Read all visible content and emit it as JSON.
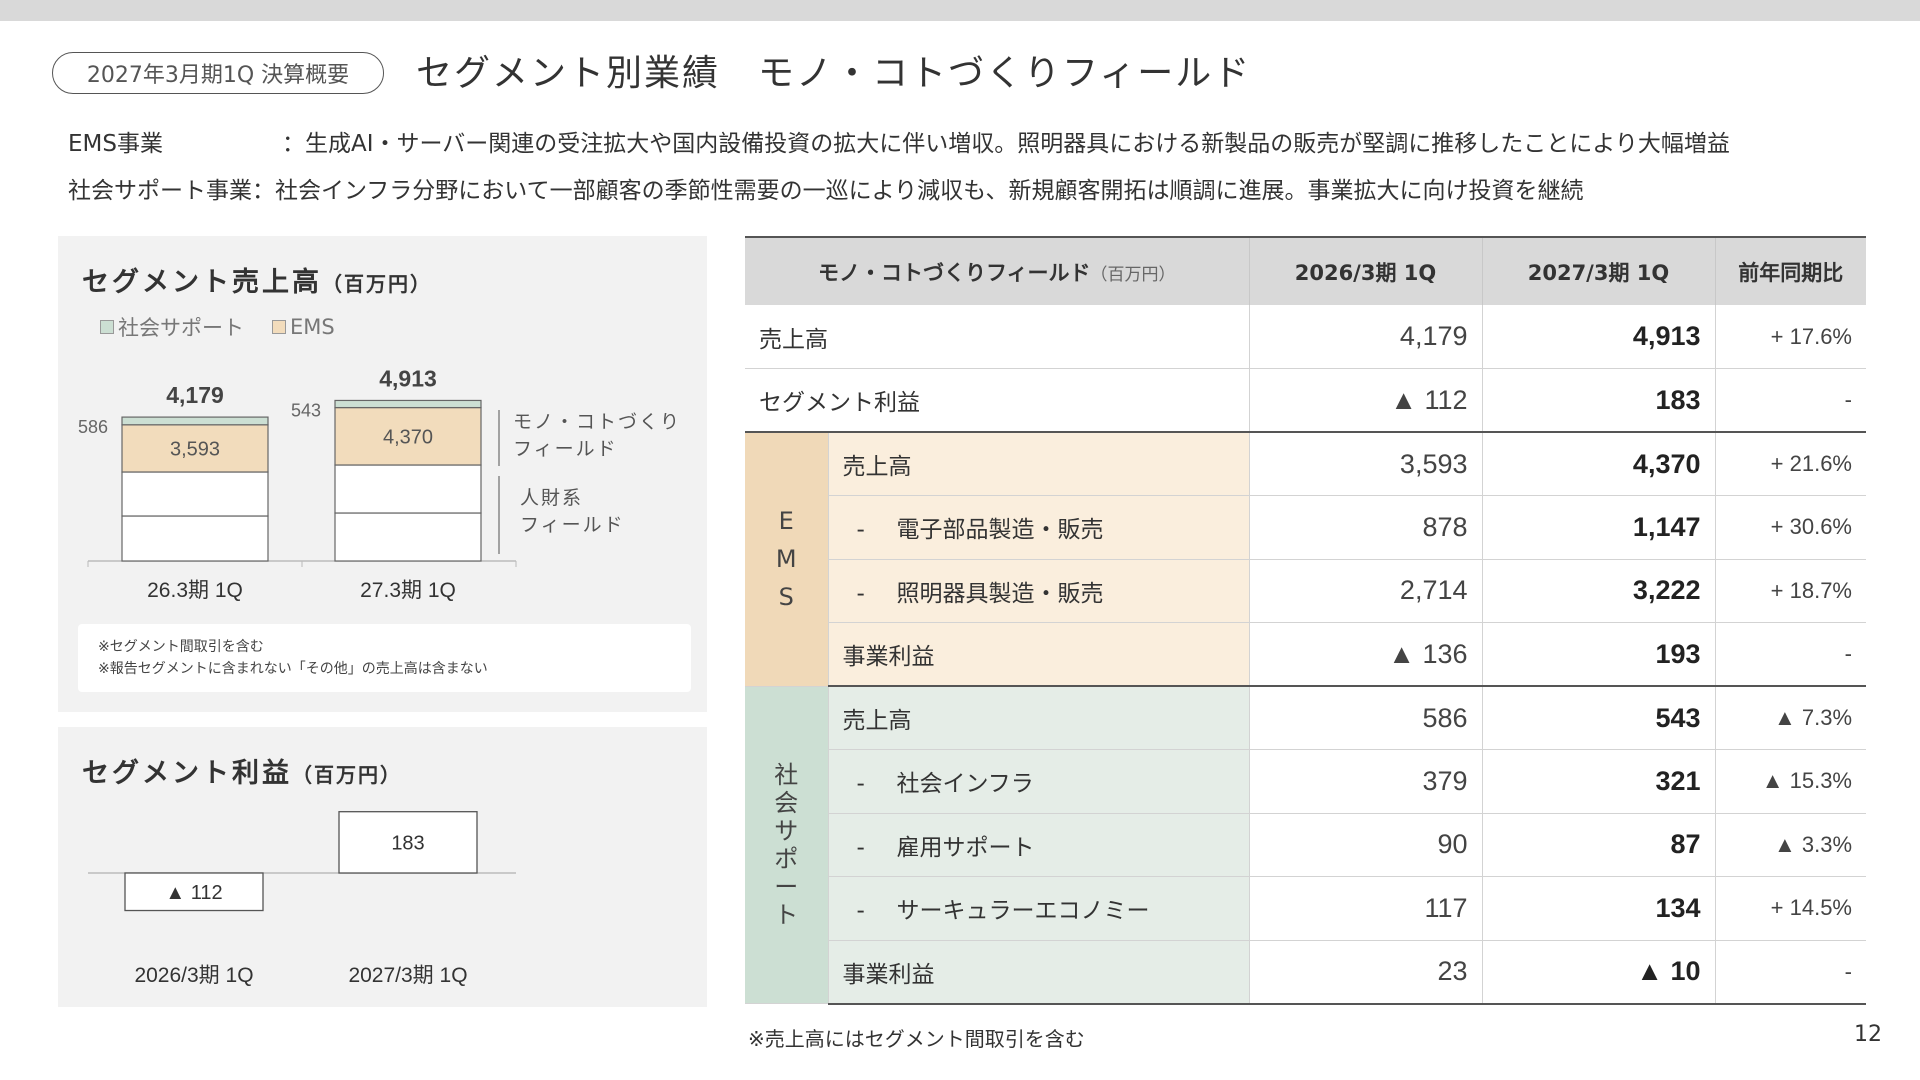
{
  "header": {
    "period_badge": "2027年3月期1Q 決算概要",
    "title": "セグメント別業績　モノ・コトづくりフィールド"
  },
  "summary": [
    {
      "label": "EMS事業",
      "text": "：生成AI・サーバー関連の受注拡大や国内設備投資の拡大に伴い増収。照明器具における新製品の販売が堅調に推移したことにより大幅増益"
    },
    {
      "label": "社会サポート事業",
      "text": "：社会インフラ分野において一部顧客の季節性需要の一巡により減収も、新規顧客開拓は順調に進展。事業拡大に向け投資を継続"
    }
  ],
  "sales_panel": {
    "title": "セグメント売上高",
    "unit": "（百万円）",
    "legend": [
      "社会サポート",
      "EMS"
    ],
    "group_labels": [
      "モノ・コトづくり\nフィールド",
      "人財系\nフィールド"
    ],
    "group_label_lines": [
      [
        "モノ・コトづくり",
        "フィールド"
      ],
      [
        "人財系",
        "フィールド"
      ]
    ],
    "notes": [
      "※セグメント間取引を含む",
      "※報告セグメントに含まれない「その他」の売上高は含まない"
    ]
  },
  "profit_panel": {
    "title": "セグメント利益",
    "unit": "（百万円）"
  },
  "chart_data": [
    {
      "type": "bar",
      "title": "セグメント売上高（百万円）",
      "stacked": true,
      "categories": [
        "26.3期 1Q",
        "27.3期 1Q"
      ],
      "series": [
        {
          "name": "EMS",
          "values": [
            3593,
            4370
          ],
          "color": "#f2dcbc"
        },
        {
          "name": "社会サポート",
          "values": [
            586,
            543
          ],
          "color": "#ccdfd3"
        }
      ],
      "totals": [
        "4,179",
        "4,913"
      ],
      "value_labels": {
        "EMS": [
          "3,593",
          "4,370"
        ],
        "社会サポート": [
          "586",
          "543"
        ]
      }
    },
    {
      "type": "bar",
      "title": "セグメント利益（百万円）",
      "categories": [
        "2026/3期 1Q",
        "2027/3期 1Q"
      ],
      "values": [
        -112,
        183
      ],
      "value_labels": [
        "▲ 112",
        "183"
      ]
    }
  ],
  "table": {
    "headers": [
      "モノ・コトづくりフィールド",
      "2026/3期 1Q",
      "2027/3期 1Q",
      "前年同期比"
    ],
    "header_unit": "（百万円）",
    "top_rows": [
      {
        "label": "売上高",
        "prev": "4,179",
        "curr": "4,913",
        "yoy": "+ 17.6%"
      },
      {
        "label": "セグメント利益",
        "prev": "▲ 112",
        "curr": "183",
        "yoy": "-"
      }
    ],
    "ems": {
      "segment": [
        "E",
        "M",
        "S"
      ],
      "rows": [
        {
          "dash": "",
          "label": "売上高",
          "prev": "3,593",
          "curr": "4,370",
          "yoy": "+ 21.6%"
        },
        {
          "dash": "-",
          "label": "電子部品製造・販売",
          "prev": "878",
          "curr": "1,147",
          "yoy": "+ 30.6%"
        },
        {
          "dash": "-",
          "label": "照明器具製造・販売",
          "prev": "2,714",
          "curr": "3,222",
          "yoy": "+ 18.7%"
        },
        {
          "dash": "",
          "label": "事業利益",
          "prev": "▲ 136",
          "curr": "193",
          "yoy": "-"
        }
      ]
    },
    "social": {
      "segment": [
        "社",
        "会",
        "サ",
        "ポ",
        "ー",
        "ト"
      ],
      "rows": [
        {
          "dash": "",
          "label": "売上高",
          "prev": "586",
          "curr": "543",
          "yoy": "▲ 7.3%"
        },
        {
          "dash": "-",
          "label": "社会インフラ",
          "prev": "379",
          "curr": "321",
          "yoy": "▲ 15.3%"
        },
        {
          "dash": "-",
          "label": "雇用サポート",
          "prev": "90",
          "curr": "87",
          "yoy": "▲ 3.3%"
        },
        {
          "dash": "-",
          "label": "サーキュラーエコノミー",
          "prev": "117",
          "curr": "134",
          "yoy": "+ 14.5%"
        },
        {
          "dash": "",
          "label": "事業利益",
          "prev": "23",
          "curr": "▲ 10",
          "yoy": "-"
        }
      ]
    }
  },
  "footer": {
    "note": "※売上高にはセグメント間取引を含む",
    "page_number": "12"
  }
}
